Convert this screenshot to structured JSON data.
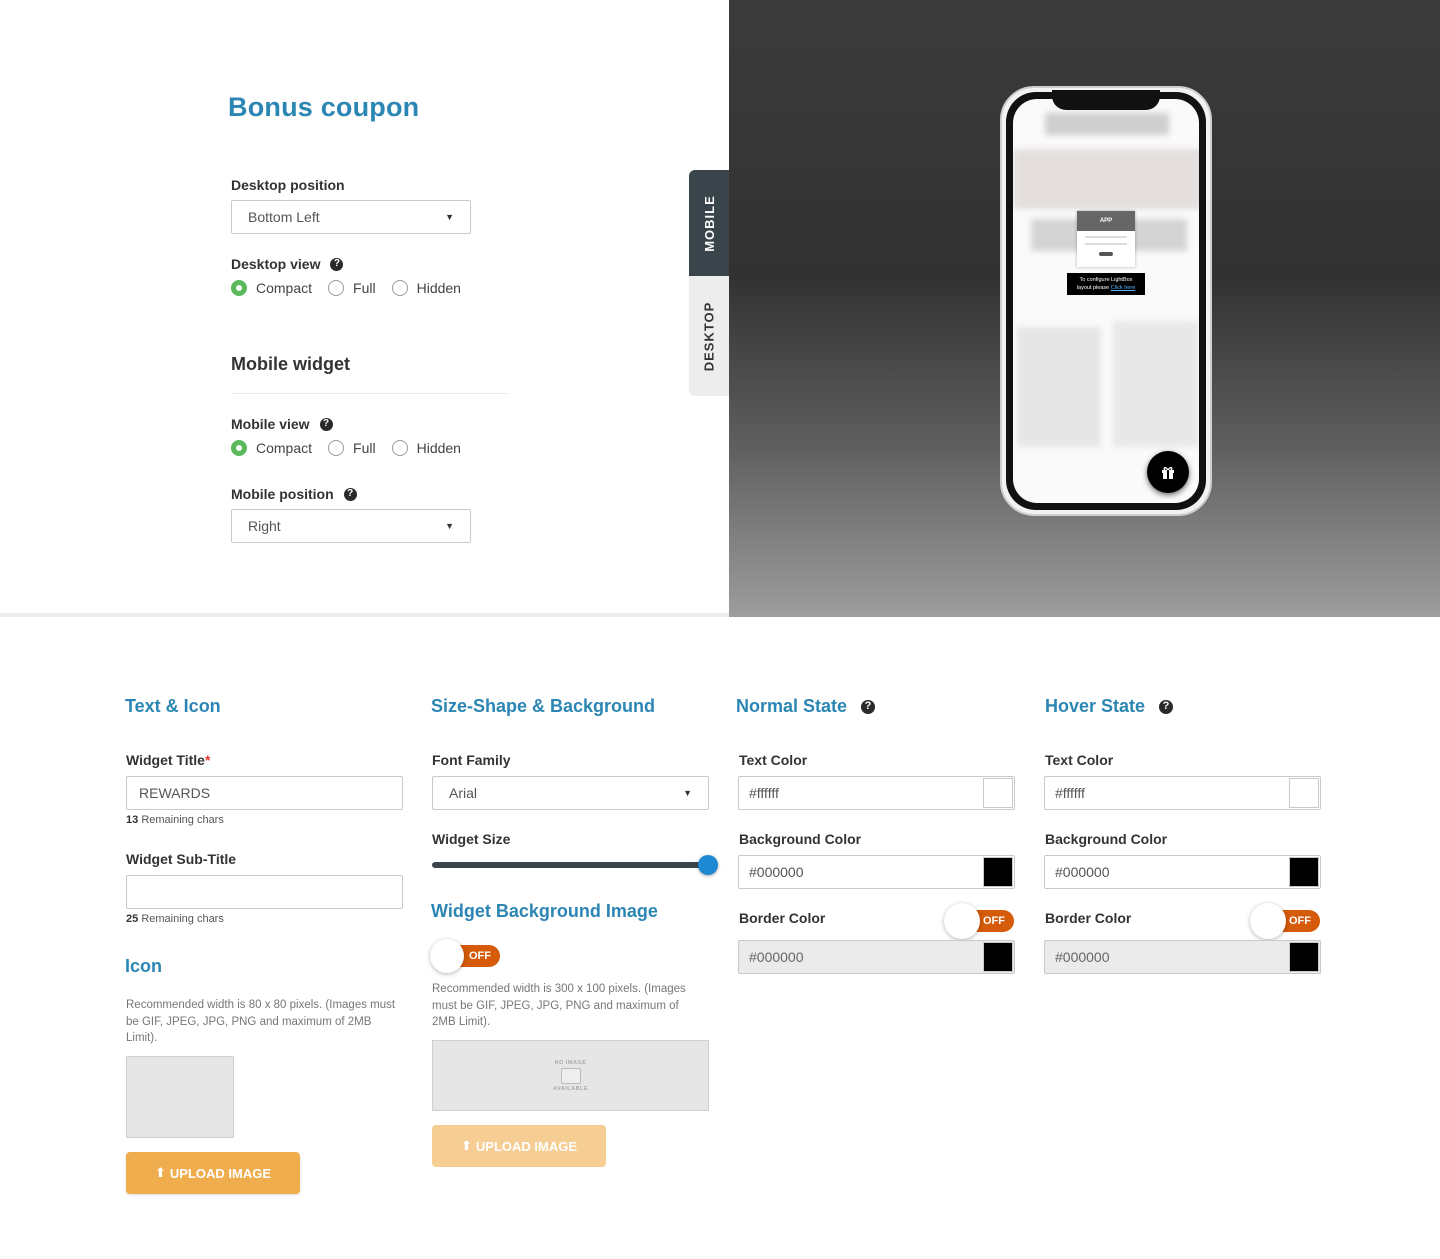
{
  "page": {
    "title": "Bonus coupon"
  },
  "desktop_position": {
    "label": "Desktop position",
    "value": "Bottom Left"
  },
  "desktop_view": {
    "label": "Desktop view",
    "options": [
      "Compact",
      "Full",
      "Hidden"
    ],
    "selected": "Compact"
  },
  "mobile_widget": {
    "title": "Mobile widget"
  },
  "mobile_view": {
    "label": "Mobile view",
    "options": [
      "Compact",
      "Full",
      "Hidden"
    ],
    "selected": "Compact"
  },
  "mobile_position": {
    "label": "Mobile position",
    "value": "Right"
  },
  "tabs": {
    "mobile": "MOBILE",
    "desktop": "DESKTOP",
    "active": "MOBILE"
  },
  "preview": {
    "modal_header": "APP",
    "tip_line1": "To configure LightBox",
    "tip_line2": "layout please",
    "tip_link": "Click here",
    "widget_icon": "gift-icon"
  },
  "text_icon": {
    "title": "Text & Icon",
    "widget_title_label": "Widget Title",
    "required_mark": "*",
    "widget_title_value": "REWARDS",
    "widget_title_remaining": "13",
    "remaining_suffix": "Remaining chars",
    "widget_subtitle_label": "Widget Sub-Title",
    "widget_subtitle_value": "",
    "widget_subtitle_remaining": "25",
    "icon_title": "Icon",
    "icon_desc": "Recommended width is 80 x 80 pixels. (Images must be GIF, JPEG, JPG, PNG and maximum of 2MB Limit).",
    "upload_label": "UPLOAD IMAGE"
  },
  "size_shape": {
    "title": "Size-Shape & Background",
    "font_family_label": "Font Family",
    "font_family_value": "Arial",
    "widget_size_label": "Widget Size",
    "widget_size_level": 1.0,
    "bg_image_title": "Widget Background Image",
    "bg_toggle": "OFF",
    "bg_desc": "Recommended width is 300 x 100 pixels. (Images must be GIF, JPEG, JPG, PNG and maximum of 2MB Limit).",
    "no_image_top": "NO IMAGE",
    "no_image_bottom": "AVAILABLE",
    "upload_label": "UPLOAD IMAGE"
  },
  "normal_state": {
    "title": "Normal State",
    "text_color_label": "Text Color",
    "text_color": "#ffffff",
    "bg_color_label": "Background Color",
    "bg_color": "#000000",
    "border_color_label": "Border Color",
    "border_toggle": "OFF",
    "border_color": "#000000"
  },
  "hover_state": {
    "title": "Hover State",
    "text_color_label": "Text Color",
    "text_color": "#ffffff",
    "bg_color_label": "Background Color",
    "bg_color": "#000000",
    "border_color_label": "Border Color",
    "border_toggle": "OFF",
    "border_color": "#000000"
  },
  "colors": {
    "accent_blue": "#2b86b4",
    "radio_green": "#5cb85c",
    "toggle_off": "#d55a0a",
    "upload_orange": "#f0ad4e",
    "tab_dark": "#39454b",
    "slider_thumb": "#1f88d3"
  }
}
